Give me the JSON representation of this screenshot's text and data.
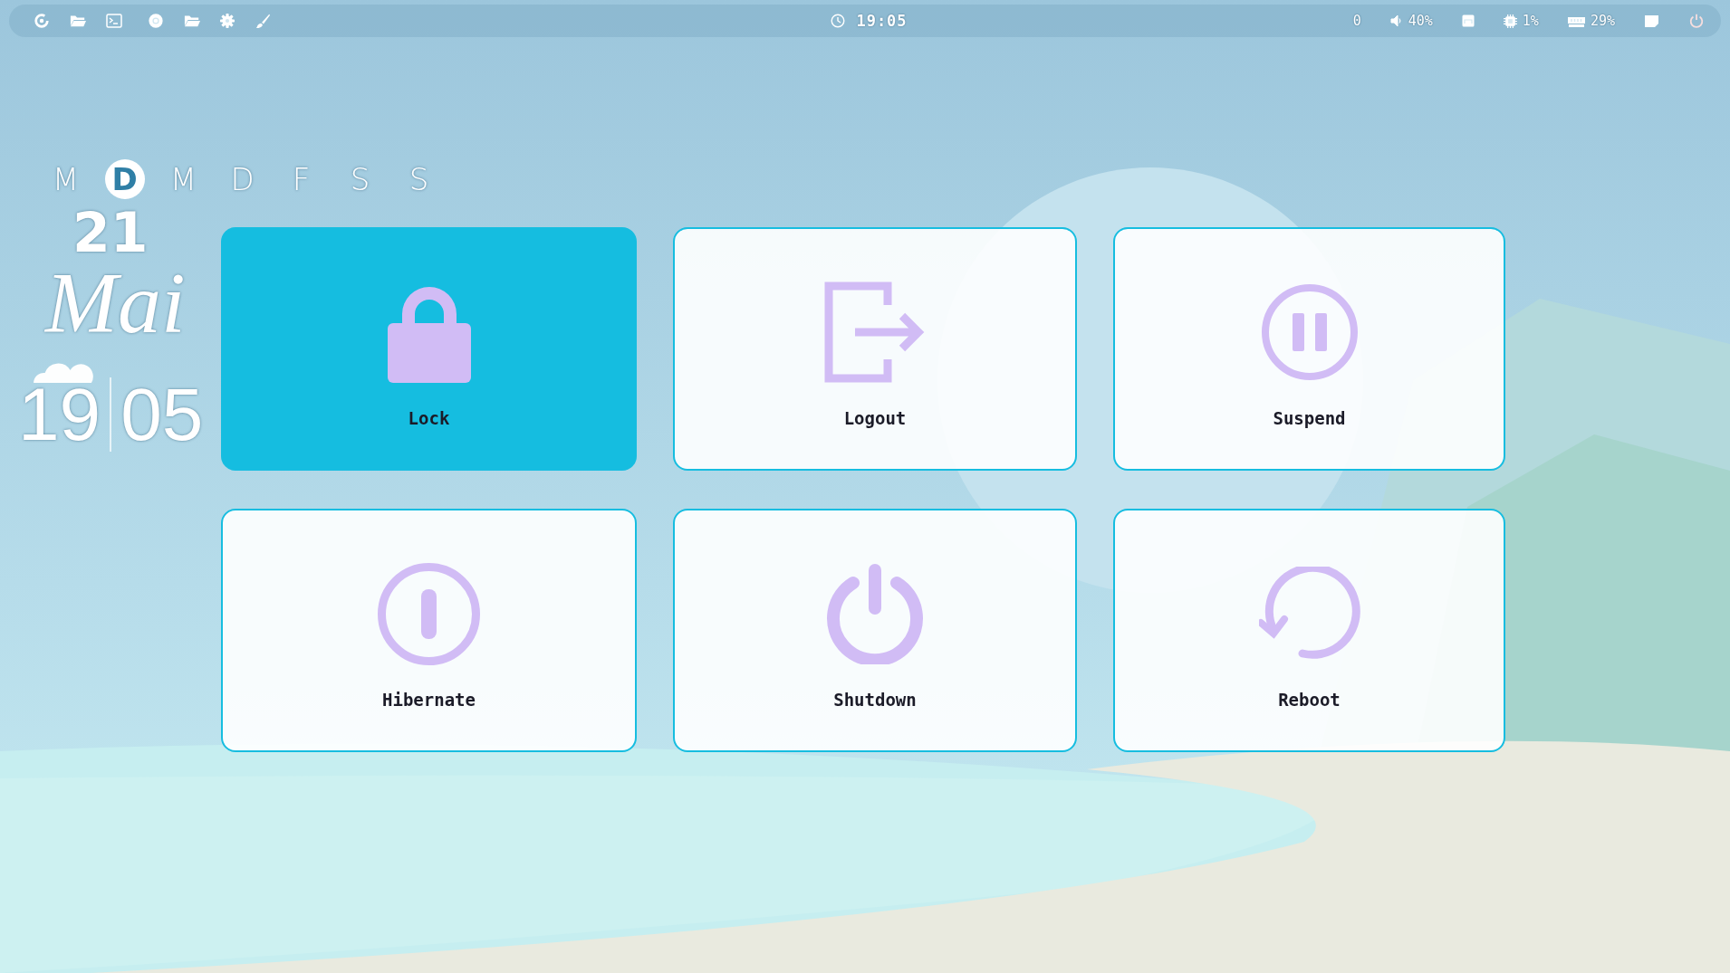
{
  "top_bar": {
    "clock": "19:05",
    "status": [
      {
        "kind": "count",
        "text": "0"
      },
      {
        "kind": "volume",
        "text": "40%"
      },
      {
        "kind": "network"
      },
      {
        "kind": "cpu",
        "text": "1%"
      },
      {
        "kind": "memory",
        "text": "29%"
      },
      {
        "kind": "notes"
      },
      {
        "kind": "power"
      }
    ]
  },
  "calendar": {
    "weekdays": [
      {
        "label": "M",
        "selected": false
      },
      {
        "label": "D",
        "selected": true
      },
      {
        "label": "M",
        "selected": false
      },
      {
        "label": "D",
        "selected": false
      },
      {
        "label": "F",
        "selected": false
      },
      {
        "label": "S",
        "selected": false
      },
      {
        "label": "S",
        "selected": false
      }
    ],
    "day": "21",
    "month": "Mai",
    "hours": "19",
    "minutes": "05"
  },
  "power_menu": {
    "actions": [
      {
        "kind": "lock",
        "label": "Lock",
        "selected": true
      },
      {
        "kind": "logout",
        "label": "Logout",
        "selected": false
      },
      {
        "kind": "suspend",
        "label": "Suspend",
        "selected": false
      },
      {
        "kind": "hibernate",
        "label": "Hibernate",
        "selected": false
      },
      {
        "kind": "shutdown",
        "label": "Shutdown",
        "selected": false
      },
      {
        "kind": "reboot",
        "label": "Reboot",
        "selected": false
      }
    ]
  }
}
